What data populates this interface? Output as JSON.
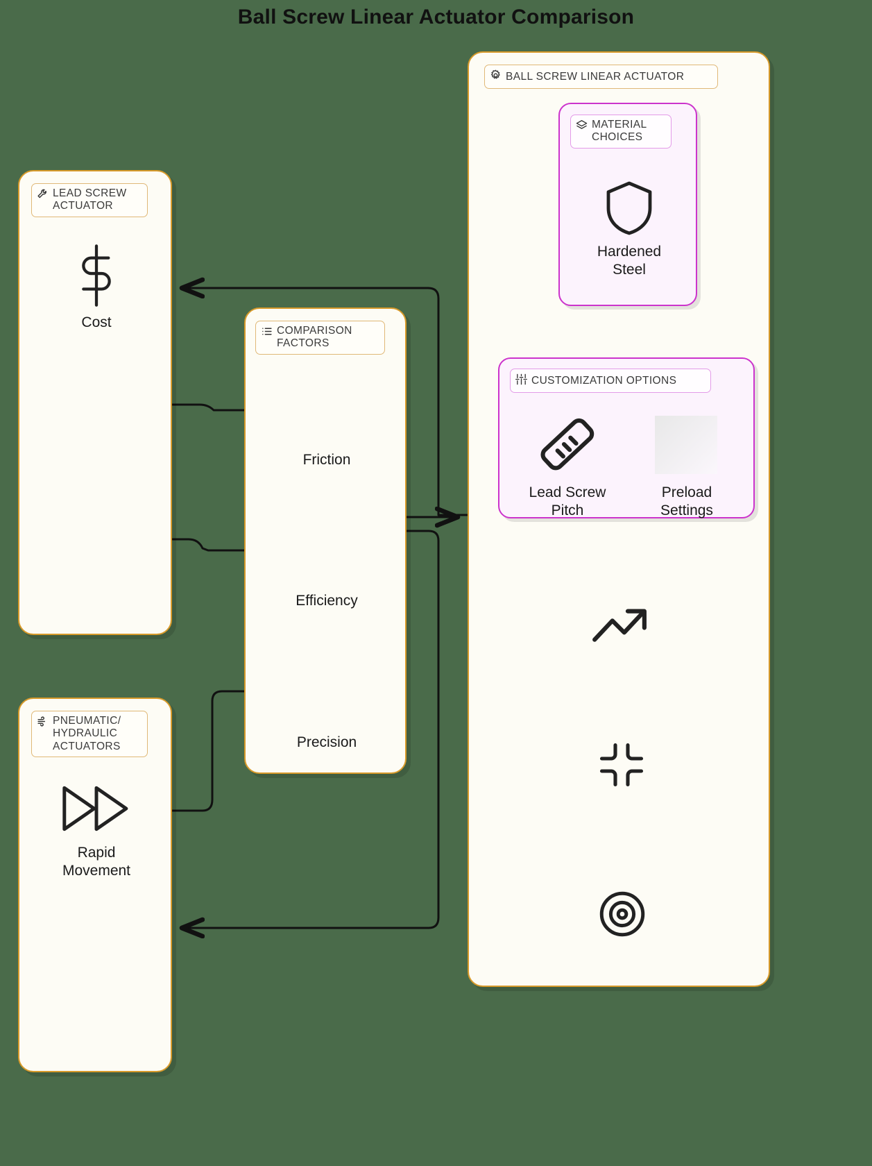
{
  "title": "Ball Screw Linear Actuator Comparison",
  "theme": {
    "background": "#4a6b4a",
    "card_fill": "#fdfcf5",
    "card_border": "#d89a2a",
    "accent_purple": "#cc33cc",
    "purple_fill": "#fcf3fd",
    "text": "#1a1a1a"
  },
  "cards": {
    "lead_screw": {
      "chip_label": "LEAD SCREW\nACTUATOR",
      "chip_icon": "wrench-icon",
      "item_icon": "dollar-icon",
      "item_label": "Cost"
    },
    "pneumatic": {
      "chip_label": "PNEUMATIC/\nHYDRAULIC\nACTUATORS",
      "chip_icon": "wind-icon",
      "item_icon": "fast-forward-icon",
      "item_label": "Rapid\nMovement"
    },
    "comparison": {
      "chip_label": "COMPARISON\nFACTORS",
      "chip_icon": "list-icon",
      "factors": [
        "Friction",
        "Efficiency",
        "Precision"
      ]
    },
    "ball_screw": {
      "chip_label": "BALL SCREW LINEAR ACTUATOR",
      "chip_icon": "gear-icon",
      "material_choices": {
        "chip_label": "MATERIAL\nCHOICES",
        "chip_icon": "layers-icon",
        "items": [
          {
            "icon": "shield-icon",
            "label": "Hardened\nSteel"
          }
        ]
      },
      "customization_options": {
        "chip_label": "CUSTOMIZATION OPTIONS",
        "chip_icon": "sliders-icon",
        "items": [
          {
            "icon": "ruler-icon",
            "label": "Lead Screw\nPitch"
          },
          {
            "icon": "blank-image-icon",
            "label": "Preload\nSettings"
          }
        ]
      },
      "loose_icons": [
        "trending-up-icon",
        "shrink-corners-icon",
        "target-icon"
      ]
    }
  }
}
